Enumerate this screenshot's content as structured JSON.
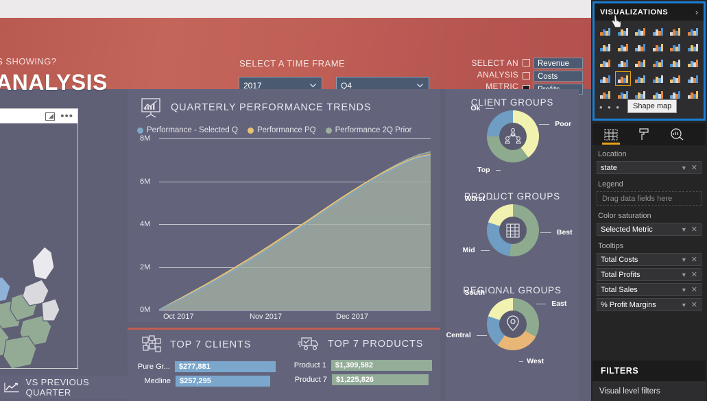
{
  "header": {
    "subtitle": "ORS SHOWING?",
    "title": "ANALYSIS",
    "timeframe_label": "SELECT A TIME FRAME",
    "year_value": "2017",
    "quarter_value": "Q4",
    "metric_line1": "SELECT AN",
    "metric_line2": "ANALYSIS",
    "metric_line3": "METRIC",
    "metrics": [
      {
        "label": "Revenue",
        "checked": false
      },
      {
        "label": "Costs",
        "checked": false
      },
      {
        "label": "Profits",
        "checked": true
      }
    ]
  },
  "map_card": {
    "focus_icon": "focus-mode-icon",
    "more_icon": "more-options-icon"
  },
  "vs_previous": {
    "label": "VS PREVIOUS QUARTER",
    "icon": "line-chart-icon"
  },
  "trends": {
    "title": "QUARTERLY PERFORMANCE TRENDS",
    "icon": "presentation-chart-icon"
  },
  "chart_data": {
    "type": "area",
    "title": "QUARTERLY PERFORMANCE TRENDS",
    "xlabel": "",
    "ylabel": "",
    "ylim": [
      0,
      8000000
    ],
    "yticks": [
      "0M",
      "2M",
      "4M",
      "6M",
      "8M"
    ],
    "xticks": [
      "Oct 2017",
      "Nov 2017",
      "Dec 2017"
    ],
    "grid": true,
    "legend_position": "top",
    "series": [
      {
        "name": "Performance - Selected Q",
        "color": "#7fa8c9",
        "values": [
          0,
          260000,
          520000,
          790000,
          1060000,
          1340000,
          1640000,
          1950000,
          2260000,
          2580000,
          2920000,
          3270000,
          3620000,
          3980000,
          4350000,
          4720000,
          5080000,
          5420000,
          5760000,
          6080000,
          6380000,
          6660000,
          6920000,
          7110000,
          7210000
        ]
      },
      {
        "name": "Performance PQ",
        "color": "#e8c274",
        "values": [
          0,
          290000,
          570000,
          860000,
          1150000,
          1450000,
          1760000,
          2080000,
          2400000,
          2730000,
          3070000,
          3420000,
          3770000,
          4120000,
          4480000,
          4840000,
          5190000,
          5530000,
          5860000,
          6170000,
          6460000,
          6730000,
          6970000,
          7160000,
          7250000
        ]
      },
      {
        "name": "Performance 2Q Prior",
        "color": "#9dada0",
        "values": [
          0,
          280000,
          560000,
          840000,
          1130000,
          1420000,
          1720000,
          2030000,
          2350000,
          2680000,
          3020000,
          3370000,
          3720000,
          4080000,
          4440000,
          4800000,
          5160000,
          5510000,
          5850000,
          6180000,
          6490000,
          6780000,
          7040000,
          7250000,
          7380000
        ]
      }
    ]
  },
  "top7": {
    "clients": {
      "title": "TOP 7 CLIENTS",
      "icon": "network-nodes-icon",
      "bar_color": "#7ba7cd",
      "rows": [
        {
          "name": "Pure Gr...",
          "value": "$277,881",
          "pct": 100
        },
        {
          "name": "Medline",
          "value": "$257,295",
          "pct": 92
        }
      ]
    },
    "products": {
      "title": "TOP 7 PRODUCTS",
      "icon": "delivery-truck-icon",
      "bar_color": "#93ad98",
      "rows": [
        {
          "name": "Product 1",
          "value": "$1,309,582",
          "pct": 100
        },
        {
          "name": "Product 7",
          "value": "$1,225,826",
          "pct": 94
        }
      ]
    }
  },
  "groups": [
    {
      "title": "CLIENT GROUPS",
      "icon": "org-people-icon",
      "slices": [
        {
          "label": "Poor",
          "pct": 40,
          "color": "#f2f2b0"
        },
        {
          "label": "Top",
          "pct": 35,
          "color": "#8fab8f"
        },
        {
          "label": "Ok",
          "pct": 25,
          "color": "#6f9dc4"
        }
      ]
    },
    {
      "title": "PRODUCT GROUPS",
      "icon": "warehouse-icon",
      "slices": [
        {
          "label": "Best",
          "pct": 52,
          "color": "#8fab8f"
        },
        {
          "label": "Mid",
          "pct": 28,
          "color": "#6f9dc4"
        },
        {
          "label": "Worst",
          "pct": 20,
          "color": "#f2f2b0"
        }
      ]
    },
    {
      "title": "REGIONAL GROUPS",
      "icon": "map-pin-icon",
      "slices": [
        {
          "label": "East",
          "pct": 33,
          "color": "#8fab8f"
        },
        {
          "label": "West",
          "pct": 27,
          "color": "#e8b776"
        },
        {
          "label": "Central",
          "pct": 20,
          "color": "#6f9dc4"
        },
        {
          "label": "South",
          "pct": 20,
          "color": "#f2f2b0"
        }
      ]
    }
  ],
  "visualizations": {
    "title": "VISUALIZATIONS",
    "expand_icon": "chevron-right-icon",
    "tooltip": "Shape map",
    "selected_icon": "shape-map-icon",
    "more_label": "• • •",
    "icons": [
      "stacked-bar-chart-icon",
      "stacked-column-chart-icon",
      "clustered-bar-chart-icon",
      "clustered-column-chart-icon",
      "100-stacked-bar-chart-icon",
      "100-stacked-column-chart-icon",
      "line-chart-icon",
      "area-chart-icon",
      "stacked-area-chart-icon",
      "line-stacked-column-chart-icon",
      "line-clustered-column-chart-icon",
      "ribbon-chart-icon",
      "waterfall-chart-icon",
      "scatter-chart-icon",
      "pie-chart-icon",
      "donut-chart-icon",
      "treemap-icon",
      "map-icon",
      "filled-map-icon",
      "shape-map-icon",
      "funnel-icon",
      "gauge-icon",
      "card-icon",
      "multi-row-card-icon",
      "kpi-icon",
      "slicer-icon",
      "table-icon",
      "matrix-icon",
      "r-script-visual-icon",
      "arcgis-map-icon"
    ]
  },
  "field_tabs": [
    {
      "name": "fields-tab",
      "icon": "fields-grid-icon",
      "active": true
    },
    {
      "name": "format-tab",
      "icon": "paint-roller-icon",
      "active": false
    },
    {
      "name": "analytics-tab",
      "icon": "magnifier-chart-icon",
      "active": false
    }
  ],
  "field_wells": [
    {
      "section": "Location",
      "type": "pill",
      "value": "state"
    },
    {
      "section": "Legend",
      "type": "drop",
      "value": "Drag data fields here"
    },
    {
      "section": "Color saturation",
      "type": "pill",
      "value": "Selected Metric"
    },
    {
      "section": "Tooltips",
      "type": "pill",
      "value": "Total Costs"
    },
    {
      "section": "",
      "type": "pill",
      "value": "Total Profits"
    },
    {
      "section": "",
      "type": "pill",
      "value": "Total Sales"
    },
    {
      "section": "",
      "type": "pill",
      "value": "% Profit Margins"
    }
  ],
  "filters": {
    "title": "FILTERS",
    "visual_level": "Visual level filters"
  }
}
